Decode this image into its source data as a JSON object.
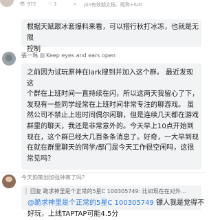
{
  "stats": {
    "views": "972",
    "hearts": "1",
    "tag": "pin有效期文档、昵称+IUD"
  },
  "quote1": {
    "line1": "根据天赋跟冰套爆料来看，可以搭行秋打冰冻，也就是无限",
    "line2": "控制"
  },
  "post": {
    "username": "張一瑪",
    "badge": "Keep eyes and ears open",
    "lines": [
      "之前因为试玩原神在lark搜到并加入这个群。 最近发现这",
      "个群在上班时间一直持续在闪，所以这两天我留心了下，",
      "发现有一些同学经常在上班时间非常专注的聊游戏。 虽",
      "然公司不禁止上班时间偶尔闲聊，但是连续几天都在游戏",
      "群里的聊天，我还是非常意外的。今天早上10点开始到",
      "现在，这个群已经大几百条条消息了。好奇，一大早到现",
      "在就在群里聊天的同学/部门是今天工作很空闲吗，这很",
      "常见吗？"
    ]
  },
  "reply": {
    "username": "今天狗策划加强钟离了吗？",
    "quote": "回复 跪求神里是个正常的5星C 100305749: 比如现在在对外...",
    "mention": "@跪求神里是个正常的5星C 100305749",
    "msg_rest": " 镖人我是觉得不",
    "line2": "好玩，上线TAPTAP可能4.5分"
  }
}
